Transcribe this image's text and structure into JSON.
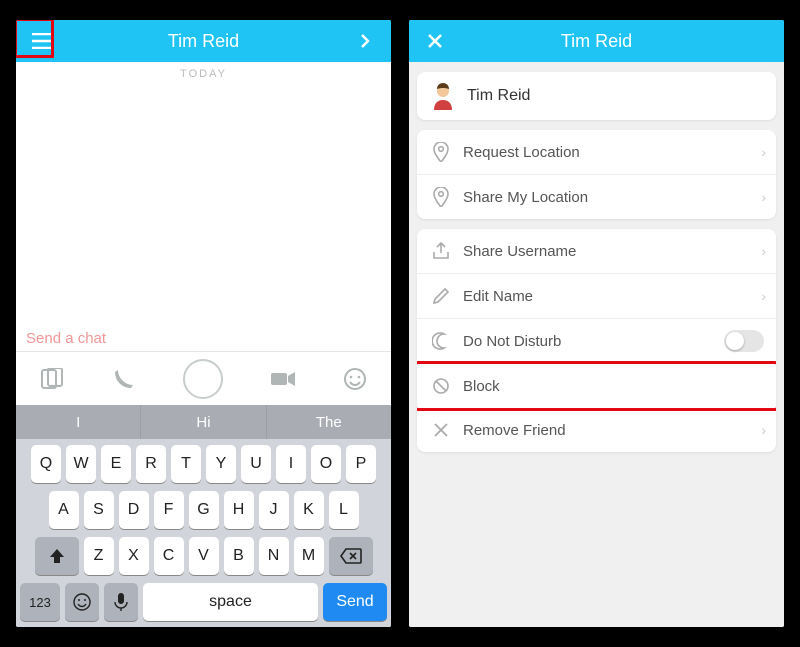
{
  "colors": {
    "accent": "#1fc4f4",
    "highlight": "#e30613",
    "send": "#1f8bf2"
  },
  "left": {
    "header": {
      "title": "Tim Reid"
    },
    "chat": {
      "today_label": "TODAY",
      "input_placeholder": "Send a chat"
    },
    "suggestions": [
      "I",
      "Hi",
      "The"
    ],
    "keyboard": {
      "row1": [
        "Q",
        "W",
        "E",
        "R",
        "T",
        "Y",
        "U",
        "I",
        "O",
        "P"
      ],
      "row2": [
        "A",
        "S",
        "D",
        "F",
        "G",
        "H",
        "J",
        "K",
        "L"
      ],
      "row3": [
        "Z",
        "X",
        "C",
        "V",
        "B",
        "N",
        "M"
      ],
      "numkey": "123",
      "space": "space",
      "send": "Send"
    }
  },
  "right": {
    "header": {
      "title": "Tim Reid"
    },
    "profile_name": "Tim Reid",
    "rows": {
      "request_location": "Request Location",
      "share_my_location": "Share My Location",
      "share_username": "Share Username",
      "edit_name": "Edit Name",
      "dnd": "Do Not Disturb",
      "block": "Block",
      "remove_friend": "Remove Friend"
    }
  }
}
